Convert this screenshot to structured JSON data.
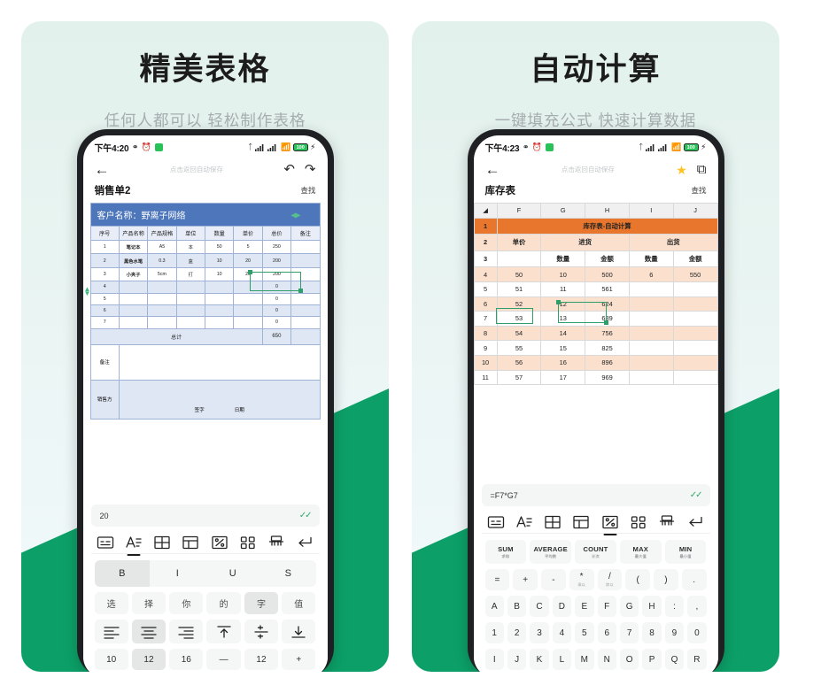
{
  "theme": {
    "accent_green": "#0ca068",
    "card_bg_top": "#e2f1ec",
    "sheet1_header": "#4d76bb",
    "sheet2_header": "#e8762c"
  },
  "cards": [
    {
      "title": "精美表格",
      "subtitle": "任何人都可以  轻松制作表格",
      "status": {
        "time": "下午4:20",
        "battery": "100"
      },
      "nav": {
        "hint": "点击返回自动保存"
      },
      "doc_title": "销售单2",
      "find": "查找",
      "sheet": {
        "banner": "客户名称：野离子网络",
        "headers": [
          "序号",
          "产品名称",
          "产品规格",
          "单位",
          "数量",
          "单价",
          "总价",
          "备注"
        ],
        "rows": [
          [
            "1",
            "笔记本",
            "A5",
            "本",
            "50",
            "5",
            "250",
            ""
          ],
          [
            "2",
            "黑色水笔",
            "0.3",
            "盒",
            "10",
            "20",
            "200",
            ""
          ],
          [
            "3",
            "小夹子",
            "5cm",
            "打",
            "10",
            "20",
            "200",
            ""
          ],
          [
            "4",
            "",
            "",
            "",
            "",
            "",
            "0",
            ""
          ],
          [
            "5",
            "",
            "",
            "",
            "",
            "",
            "0",
            ""
          ],
          [
            "6",
            "",
            "",
            "",
            "",
            "",
            "0",
            ""
          ],
          [
            "7",
            "",
            "",
            "",
            "",
            "",
            "0",
            ""
          ]
        ],
        "total_label": "总计",
        "total_value": "650",
        "note_label": "备注",
        "seller_label": "销售方",
        "sign_label": "签字",
        "date_label": "日期"
      },
      "formula_bar": {
        "value": "20"
      },
      "toolbar": [
        {
          "name": "keyboard-icon",
          "active": false
        },
        {
          "name": "text-format-icon",
          "active": true
        },
        {
          "name": "table-grid-icon",
          "active": false
        },
        {
          "name": "layout-icon",
          "active": false
        },
        {
          "name": "formula-icon",
          "active": false
        },
        {
          "name": "apps-grid-icon",
          "active": false
        },
        {
          "name": "eraser-icon",
          "active": false
        },
        {
          "name": "enter-icon",
          "active": false
        }
      ],
      "keyrows": [
        {
          "type": "segment",
          "keys": [
            {
              "label": "B",
              "on": true
            },
            {
              "label": "I",
              "on": false
            },
            {
              "label": "U",
              "on": false
            },
            {
              "label": "S",
              "on": false
            }
          ]
        },
        {
          "type": "cjk",
          "keys": [
            {
              "label": "选",
              "on": false
            },
            {
              "label": "择",
              "on": false
            },
            {
              "label": "你",
              "on": false
            },
            {
              "label": "的",
              "on": false
            },
            {
              "label": "字",
              "on": true
            },
            {
              "label": "值",
              "on": false
            }
          ]
        },
        {
          "type": "icons",
          "keys": [
            {
              "label": "align-left-icon",
              "on": false
            },
            {
              "label": "align-center-icon",
              "on": true
            },
            {
              "label": "align-right-icon",
              "on": false
            },
            {
              "label": "align-top-icon",
              "on": false
            },
            {
              "label": "align-middle-icon",
              "on": false
            },
            {
              "label": "align-bottom-icon",
              "on": false
            }
          ]
        },
        {
          "type": "small",
          "keys": [
            {
              "label": "10",
              "on": false
            },
            {
              "label": "12",
              "on": true
            },
            {
              "label": "16",
              "on": false
            },
            {
              "label": "—",
              "on": false
            },
            {
              "label": "12",
              "on": false
            },
            {
              "label": "+",
              "on": false
            }
          ]
        }
      ]
    },
    {
      "title": "自动计算",
      "subtitle": "一键填充公式 快速计算数据",
      "status": {
        "time": "下午4:23",
        "battery": "100"
      },
      "nav": {
        "hint": "点击返回自动保存"
      },
      "doc_title": "库存表",
      "find": "查找",
      "sheet": {
        "columns": [
          "F",
          "G",
          "H",
          "I",
          "J"
        ],
        "title_row": "库存表-自动计算",
        "group_headers": [
          "单价",
          "进货",
          "出货"
        ],
        "sub_headers": [
          "",
          "数量",
          "金额",
          "数量",
          "金额"
        ],
        "rows": [
          {
            "n": "4",
            "cells": [
              "50",
              "10",
              "500",
              "6",
              "550"
            ]
          },
          {
            "n": "5",
            "cells": [
              "51",
              "11",
              "561",
              "",
              ""
            ]
          },
          {
            "n": "6",
            "cells": [
              "52",
              "12",
              "624",
              "",
              ""
            ]
          },
          {
            "n": "7",
            "cells": [
              "53",
              "13",
              "689",
              "",
              ""
            ]
          },
          {
            "n": "8",
            "cells": [
              "54",
              "14",
              "756",
              "",
              ""
            ]
          },
          {
            "n": "9",
            "cells": [
              "55",
              "15",
              "825",
              "",
              ""
            ]
          },
          {
            "n": "10",
            "cells": [
              "56",
              "16",
              "896",
              "",
              ""
            ]
          },
          {
            "n": "11",
            "cells": [
              "57",
              "17",
              "969",
              "",
              ""
            ]
          }
        ],
        "row_numbers": [
          "1",
          "2",
          "3"
        ]
      },
      "formula_bar": {
        "value": "=F7*G7"
      },
      "toolbar": [
        {
          "name": "keyboard-icon",
          "active": false
        },
        {
          "name": "text-format-icon",
          "active": false
        },
        {
          "name": "table-grid-icon",
          "active": false
        },
        {
          "name": "layout-icon",
          "active": false
        },
        {
          "name": "formula-icon",
          "active": true
        },
        {
          "name": "apps-grid-icon",
          "active": false
        },
        {
          "name": "eraser-icon",
          "active": false
        },
        {
          "name": "enter-icon",
          "active": false
        }
      ],
      "keyrows": [
        {
          "type": "fn",
          "keys": [
            {
              "label": "SUM",
              "sub": "求和"
            },
            {
              "label": "AVERAGE",
              "sub": "平均数"
            },
            {
              "label": "COUNT",
              "sub": "计次"
            },
            {
              "label": "MAX",
              "sub": "最大值"
            },
            {
              "label": "MIN",
              "sub": "最小值"
            }
          ]
        },
        {
          "type": "ops",
          "keys": [
            {
              "label": "=",
              "sub": ""
            },
            {
              "label": "+",
              "sub": ""
            },
            {
              "label": "-",
              "sub": ""
            },
            {
              "label": "*",
              "sub": "乘以"
            },
            {
              "label": "/",
              "sub": "除以"
            },
            {
              "label": "(",
              "sub": ""
            },
            {
              "label": ")",
              "sub": ""
            },
            {
              "label": ".",
              "sub": ""
            }
          ]
        },
        {
          "type": "small",
          "keys": [
            {
              "label": "A"
            },
            {
              "label": "B"
            },
            {
              "label": "C"
            },
            {
              "label": "D"
            },
            {
              "label": "E"
            },
            {
              "label": "F"
            },
            {
              "label": "G"
            },
            {
              "label": "H"
            },
            {
              "label": ":"
            },
            {
              "label": ","
            }
          ]
        },
        {
          "type": "small",
          "keys": [
            {
              "label": "1"
            },
            {
              "label": "2"
            },
            {
              "label": "3"
            },
            {
              "label": "4"
            },
            {
              "label": "5"
            },
            {
              "label": "6"
            },
            {
              "label": "7"
            },
            {
              "label": "8"
            },
            {
              "label": "9"
            },
            {
              "label": "0"
            }
          ]
        },
        {
          "type": "small",
          "keys": [
            {
              "label": "I"
            },
            {
              "label": "J"
            },
            {
              "label": "K"
            },
            {
              "label": "L"
            },
            {
              "label": "M"
            },
            {
              "label": "N"
            },
            {
              "label": "O"
            },
            {
              "label": "P"
            },
            {
              "label": "Q"
            },
            {
              "label": "R"
            }
          ]
        }
      ]
    }
  ]
}
